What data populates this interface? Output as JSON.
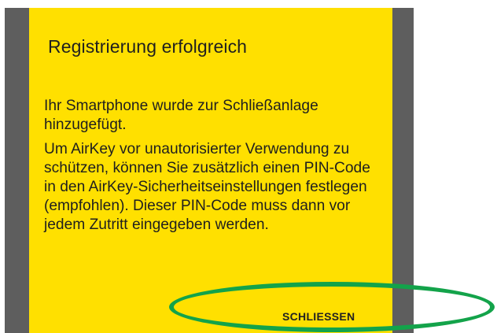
{
  "dialog": {
    "title": "Registrierung erfolgreich",
    "message_1": "Ihr Smartphone wurde zur Schließanlage hinzugefügt.",
    "message_2": "Um AirKey vor unautorisierter Verwendung zu schützen, können Sie zusätzlich einen PIN-Code in den AirKey-Sicherheitseinstellungen festlegen (empfohlen). Dieser PIN-Code muss dann vor jedem Zutritt eingegeben werden.",
    "close_label": "SCHLIESSEN"
  },
  "colors": {
    "dialog_background": "#FFE000",
    "backdrop": "#5e5e5e",
    "highlight_ring": "#13A34A",
    "text": "#1f1f1f"
  }
}
